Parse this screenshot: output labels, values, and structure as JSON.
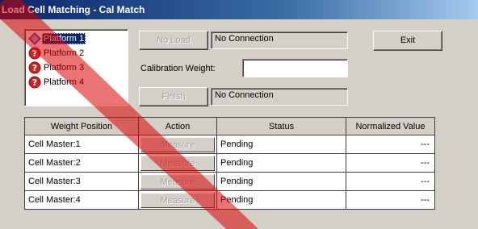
{
  "window": {
    "title": "Load Cell Matching - Cal Match"
  },
  "platforms": [
    {
      "label": "Platform 1",
      "selected": true,
      "icon": "platform-ok-icon"
    },
    {
      "label": "Platform 2",
      "selected": false,
      "icon": "question-error-icon"
    },
    {
      "label": "Platform 3",
      "selected": false,
      "icon": "question-error-icon"
    },
    {
      "label": "Platform 4",
      "selected": false,
      "icon": "question-error-icon"
    }
  ],
  "controls": {
    "no_load_button": "No Load",
    "no_load_status": "No Connection",
    "exit_button": "Exit",
    "calibration_weight_label": "Calibration Weight:",
    "calibration_weight_value": "",
    "finish_button": "Finish",
    "finish_status": "No Connection"
  },
  "table": {
    "headers": [
      "Weight Position",
      "Action",
      "Status",
      "Normalized Value"
    ],
    "rows": [
      {
        "position": "Cell Master:1",
        "action": "Measure",
        "status": "Pending",
        "value": "---"
      },
      {
        "position": "Cell Master:2",
        "action": "Measure",
        "status": "Pending",
        "value": "---"
      },
      {
        "position": "Cell Master:3",
        "action": "Measure",
        "status": "Pending",
        "value": "---"
      },
      {
        "position": "Cell Master:4",
        "action": "Measure",
        "status": "Pending",
        "value": "---"
      }
    ]
  },
  "colors": {
    "titlebar": "#0a246a",
    "window_face": "#d4d0c8",
    "selection": "#0a246a",
    "overlay_stripe": "#d80000"
  }
}
